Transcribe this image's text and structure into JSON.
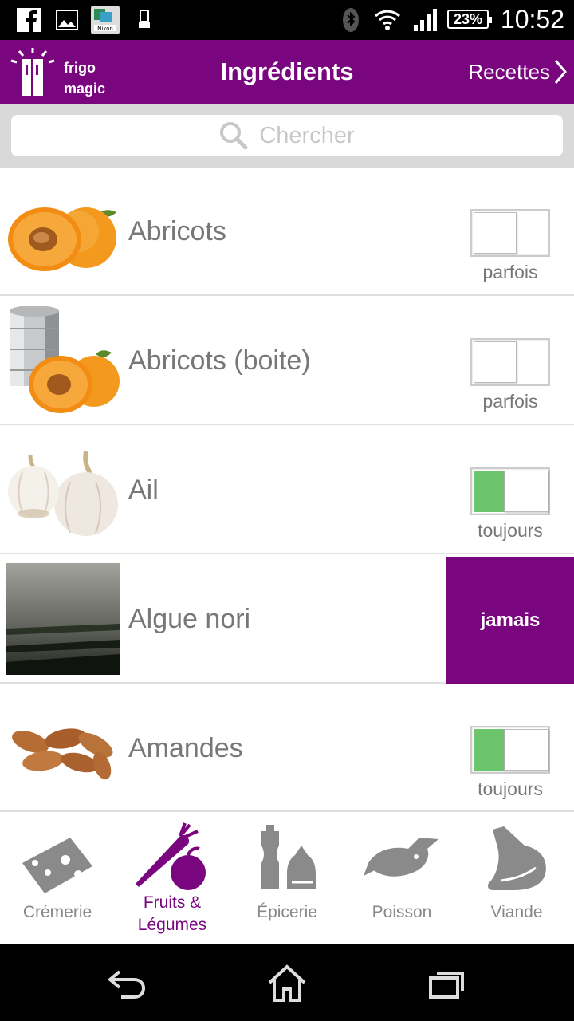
{
  "status_bar": {
    "time": "10:52",
    "battery": "23%",
    "icons": [
      "facebook-icon",
      "gallery-icon",
      "nikon-app-icon",
      "usb-icon",
      "bluetooth-icon",
      "wifi-icon",
      "signal-icon"
    ]
  },
  "app_bar": {
    "logo_line1": "frigo",
    "logo_line2": "magic",
    "title": "Ingrédients",
    "recettes_label": "Recettes"
  },
  "search": {
    "placeholder": "Chercher"
  },
  "ingredients": [
    {
      "name": "Abricots",
      "status": "parfois"
    },
    {
      "name": "Abricots (boite)",
      "status": "parfois"
    },
    {
      "name": "Ail",
      "status": "toujours"
    },
    {
      "name": "Algue nori",
      "status": "jamais"
    },
    {
      "name": "Amandes",
      "status": "toujours"
    }
  ],
  "tabs": [
    {
      "label": "Crémerie",
      "active": false
    },
    {
      "label_line1": "Fruits &",
      "label_line2": "Légumes",
      "active": true
    },
    {
      "label": "Épicerie",
      "active": false
    },
    {
      "label": "Poisson",
      "active": false
    },
    {
      "label": "Viande",
      "active": false
    }
  ],
  "colors": {
    "brand": "#79067f",
    "toggle_on": "#6cc56c",
    "tab_inactive": "#888888"
  }
}
